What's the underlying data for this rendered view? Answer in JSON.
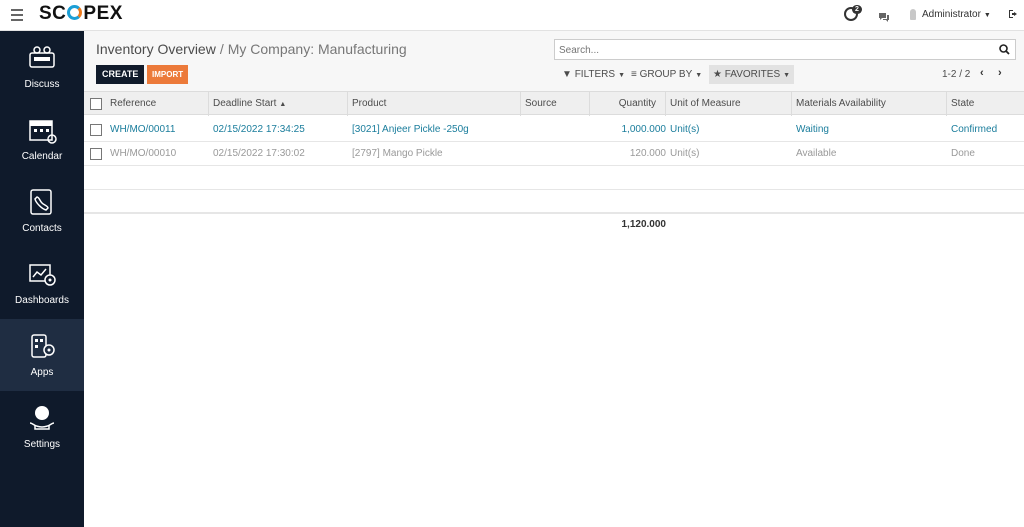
{
  "topbar": {
    "logo_left": "SC",
    "logo_right": "PEX",
    "activity_count": "2",
    "user_name": "Administrator"
  },
  "sidebar": {
    "items": [
      {
        "label": "Discuss",
        "icon": "discuss-icon"
      },
      {
        "label": "Calendar",
        "icon": "calendar-icon"
      },
      {
        "label": "Contacts",
        "icon": "contacts-icon"
      },
      {
        "label": "Dashboards",
        "icon": "dashboards-icon"
      },
      {
        "label": "Apps",
        "icon": "apps-icon"
      },
      {
        "label": "Settings",
        "icon": "settings-icon"
      }
    ],
    "active": "Apps"
  },
  "control": {
    "breadcrumb_parent": "Inventory Overview",
    "breadcrumb_sep": "/",
    "breadcrumb_current": "My Company: Manufacturing",
    "create_label": "CREATE",
    "import_label": "IMPORT",
    "search_placeholder": "Search...",
    "filters_label": "FILTERS",
    "groupby_label": "GROUP BY",
    "favorites_label": "FAVORITES",
    "pager": "1-2 / 2"
  },
  "table": {
    "columns": [
      "Reference",
      "Deadline Start",
      "Product",
      "Source",
      "Quantity",
      "Unit of Measure",
      "Materials Availability",
      "State"
    ],
    "rows": [
      {
        "reference": "WH/MO/00011",
        "deadline": "02/15/2022 17:34:25",
        "product": "[3021] Anjeer Pickle -250g",
        "source": "",
        "quantity": "1,000.000",
        "uom": "Unit(s)",
        "availability": "Waiting",
        "state": "Confirmed"
      },
      {
        "reference": "WH/MO/00010",
        "deadline": "02/15/2022 17:30:02",
        "product": "[2797] Mango Pickle",
        "source": "",
        "quantity": "120.000",
        "uom": "Unit(s)",
        "availability": "Available",
        "state": "Done"
      }
    ],
    "total_quantity": "1,120.000"
  },
  "colors": {
    "sidebar_bg": "#0f1a2b",
    "create_button": "#111b2b",
    "import_button": "#ec7a3a",
    "link": "#1a7d9c"
  }
}
